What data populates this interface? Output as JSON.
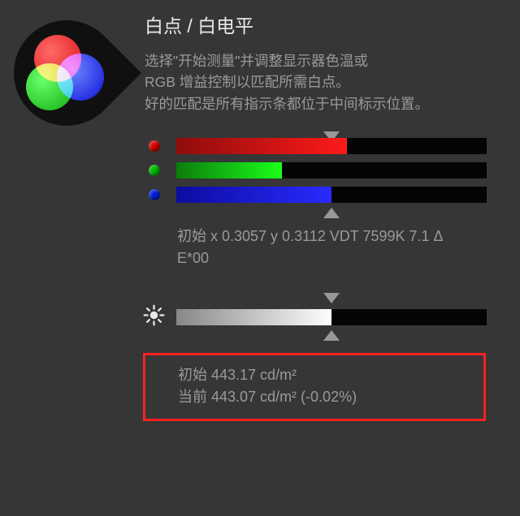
{
  "header": {
    "title": "白点 / 白电平",
    "description_line1": "选择\"开始测量\"并调整显示器色温或",
    "description_line2": "RGB 增益控制以匹配所需白点。",
    "description_line3": "好的匹配是所有指示条都位于中间标示位置。"
  },
  "bars": {
    "red_percent": 55,
    "green_percent": 34,
    "blue_percent": 50
  },
  "initial_reading": {
    "line1": "初始 x 0.3057 y 0.3112 VDT 7599K 7.1 Δ",
    "line2": "E*00"
  },
  "brightness": {
    "percent": 50
  },
  "luminance": {
    "initial": "初始 443.17 cd/m²",
    "current": "当前 443.07 cd/m² (-0.02%)"
  }
}
